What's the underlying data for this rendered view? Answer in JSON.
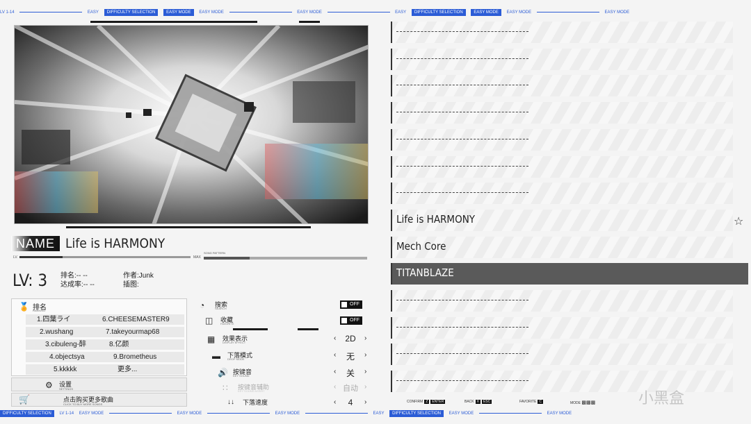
{
  "ticker": {
    "difficulty": "EASY",
    "mode": "EASY MODE",
    "selection": "DIFFICULTY SELECTION",
    "level_short": "LV 1-14",
    "level_tag": "LV 1-14"
  },
  "song": {
    "name_tag": "NAME",
    "title": "Life is HARMONY",
    "lv_prefix": "LV.",
    "lv_max": "MAX",
    "lv_progress": 0.25,
    "pattern_label": "SONG PATTERN",
    "pattern_progress": 0.28,
    "level": "LV: 3",
    "rank_label": "排名:-- --",
    "achievement_label": "达成率:-- --",
    "author_label": "作者:Junk",
    "illustration_label": "插图:"
  },
  "ranking": {
    "title": "排名",
    "subtitle": "RANKING",
    "left": [
      "1.四葉ライ",
      "2.wushang",
      "3.cibuleng-醉",
      "4.objectsya",
      "5.kkkkk"
    ],
    "right": [
      "6.CHEESEMASTER9",
      "7.takeyourmap68",
      "8.亿颜",
      "9.Brometheus",
      "更多..."
    ]
  },
  "settings": {
    "label": "设置",
    "sub": "SETTINGS"
  },
  "buy": {
    "label": "点击购买更多歌曲",
    "sub": "CLICK TO BUY MORE SONGS"
  },
  "options": {
    "search": {
      "label": "搜索",
      "sub": "SEARCH",
      "value": "OFF"
    },
    "favorite": {
      "label": "收藏",
      "sub": "FAVORITE",
      "value": "OFF"
    },
    "display_effect": {
      "label": "效果表示",
      "sub": "DISPLAY EFFECT",
      "value": "2D"
    },
    "drop_mode": {
      "label": "下落模式",
      "sub": "DROP MODE",
      "value": "无"
    },
    "key_sound": {
      "label": "按键音",
      "sub": "KEY SOUND",
      "value": "关"
    },
    "key_sound_assist": {
      "label": "按键音辅助",
      "sub": "KEY SOUND ASSIST",
      "value": "自动"
    },
    "drop_speed": {
      "label": "下落速度",
      "value": "4"
    }
  },
  "song_list": [
    {
      "title": "",
      "placeholder": true
    },
    {
      "title": "",
      "placeholder": true
    },
    {
      "title": "",
      "placeholder": true
    },
    {
      "title": "",
      "placeholder": true
    },
    {
      "title": "",
      "placeholder": true
    },
    {
      "title": "",
      "placeholder": true
    },
    {
      "title": "",
      "placeholder": true
    },
    {
      "title": "Life is HARMONY",
      "placeholder": false,
      "starred": true
    },
    {
      "title": "Mech Core",
      "placeholder": false
    },
    {
      "title": "TITANBLAZE",
      "placeholder": false,
      "selected": true
    },
    {
      "title": "",
      "placeholder": true
    },
    {
      "title": "",
      "placeholder": true
    },
    {
      "title": "",
      "placeholder": true
    },
    {
      "title": "",
      "placeholder": true
    }
  ],
  "footer": {
    "confirm": "CONFIRM",
    "confirm_key": "Z",
    "confirm_key2": "ENTER",
    "back": "BACK",
    "back_key": "X",
    "back_key2": "ESC",
    "favorite": "FAVORITE",
    "favorite_key": "C",
    "mode": "MODE"
  },
  "watermark": "小黑盒",
  "colors": {
    "accent": "#2b5cd6",
    "selected_row": "#5a5a5a",
    "toggle": "#111111"
  }
}
